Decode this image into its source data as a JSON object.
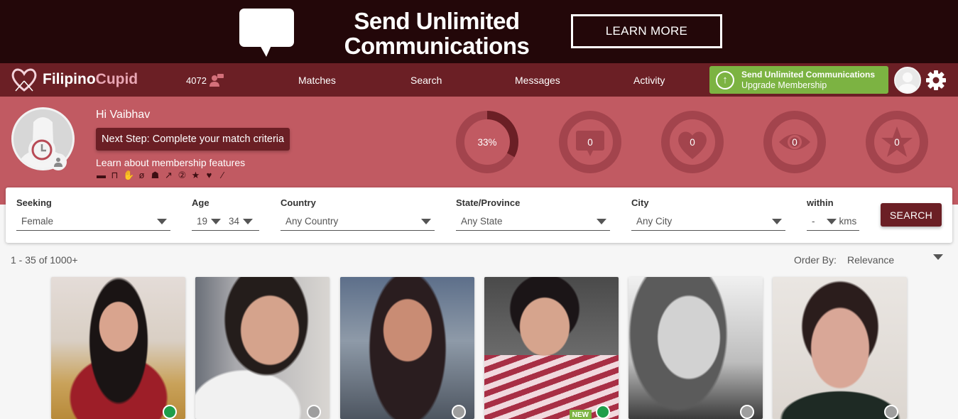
{
  "ad": {
    "headline_line1": "Send Unlimited",
    "headline_line2": "Communications",
    "cta": "LEARN MORE"
  },
  "nav": {
    "logo_part1": "Filipino",
    "logo_part2": "Cupid",
    "online_count": "4072",
    "links": [
      "Matches",
      "Search",
      "Messages",
      "Activity"
    ],
    "upgrade_title": "Send Unlimited Communications",
    "upgrade_sub": "Upgrade Membership"
  },
  "profile": {
    "greeting": "Hi Vaibhav",
    "next_step": "Next Step: Complete your match criteria",
    "learn_link": "Learn about membership features",
    "feature_icons": [
      "message-icon",
      "unlock-icon",
      "hand-icon",
      "eye-slash-icon",
      "user-plus-icon",
      "trend-icon",
      "x2-icon",
      "star-icon",
      "hearts-icon",
      "magic-wand-icon"
    ],
    "stats": [
      {
        "name": "profile-completion",
        "value": "33%",
        "progress": 0.33
      },
      {
        "name": "messages",
        "value": "0",
        "icon": "message-icon"
      },
      {
        "name": "interests",
        "value": "0",
        "icon": "heart-icon"
      },
      {
        "name": "views",
        "value": "0",
        "icon": "eye-icon"
      },
      {
        "name": "favorites",
        "value": "0",
        "icon": "star-icon"
      }
    ]
  },
  "search": {
    "seeking_label": "Seeking",
    "seeking_value": "Female",
    "age_label": "Age",
    "age_min": "19",
    "age_max": "34",
    "country_label": "Country",
    "country_value": "Any Country",
    "state_label": "State/Province",
    "state_value": "Any State",
    "city_label": "City",
    "city_value": "Any City",
    "within_label": "within",
    "within_value": "-",
    "within_unit": "kms",
    "button": "SEARCH"
  },
  "results": {
    "count": "1 - 35 of 1000+",
    "order_label": "Order By:",
    "order_value": "Relevance"
  },
  "cards": [
    {
      "online": true,
      "new": false
    },
    {
      "online": false,
      "new": false
    },
    {
      "online": false,
      "new": false
    },
    {
      "online": true,
      "new": true,
      "badge": "NEW"
    },
    {
      "online": false,
      "new": false
    },
    {
      "online": false,
      "new": false
    }
  ],
  "colors": {
    "brand_dark": "#6b1f25",
    "header_pink": "#c15a62",
    "upgrade_green": "#7cb342",
    "online_green": "#1e9e4a"
  }
}
